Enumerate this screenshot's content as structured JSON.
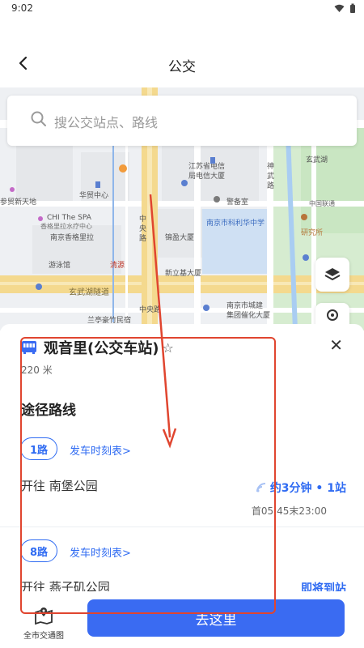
{
  "status_bar": {
    "time": "9:02"
  },
  "header": {
    "title": "公交"
  },
  "search": {
    "placeholder": "搜公交站点、路线"
  },
  "map": {
    "labels": [
      "江苏省电信",
      "局电信大厦",
      "华贸中心",
      "参贸新天地",
      "CHI The SPA",
      "香格里拉水疗中心",
      "南京香格里拉",
      "游泳馆",
      "清源",
      "中央路",
      "警备室",
      "南京市科利华中学",
      "锦盈大厦",
      "新立基大厦",
      "玄武湖隧道",
      "中央路",
      "南京市城建",
      "集团催化大厦",
      "兰亭豪竹民宿",
      "神武路",
      "玄武湖",
      "中国联通",
      "研究所"
    ]
  },
  "station": {
    "name": "观音里(公交车站)",
    "distance": "220 米",
    "section_title": "途径路线"
  },
  "routes": [
    {
      "badge": "1路",
      "timetable": "发车时刻表>",
      "toward": "开往  南堡公园",
      "arrival": "约3分钟 • 1站",
      "hours": "首05:45末23:00"
    },
    {
      "badge": "8路",
      "timetable": "发车时刻表>",
      "toward": "开往  燕子矶公园",
      "arrival": "即将到站"
    }
  ],
  "bottom": {
    "city_map_label": "全市交通图",
    "go_label": "去这里"
  },
  "colors": {
    "accent": "#2f6bf2",
    "button": "#3a6bf2",
    "annotation": "#e0452f"
  }
}
